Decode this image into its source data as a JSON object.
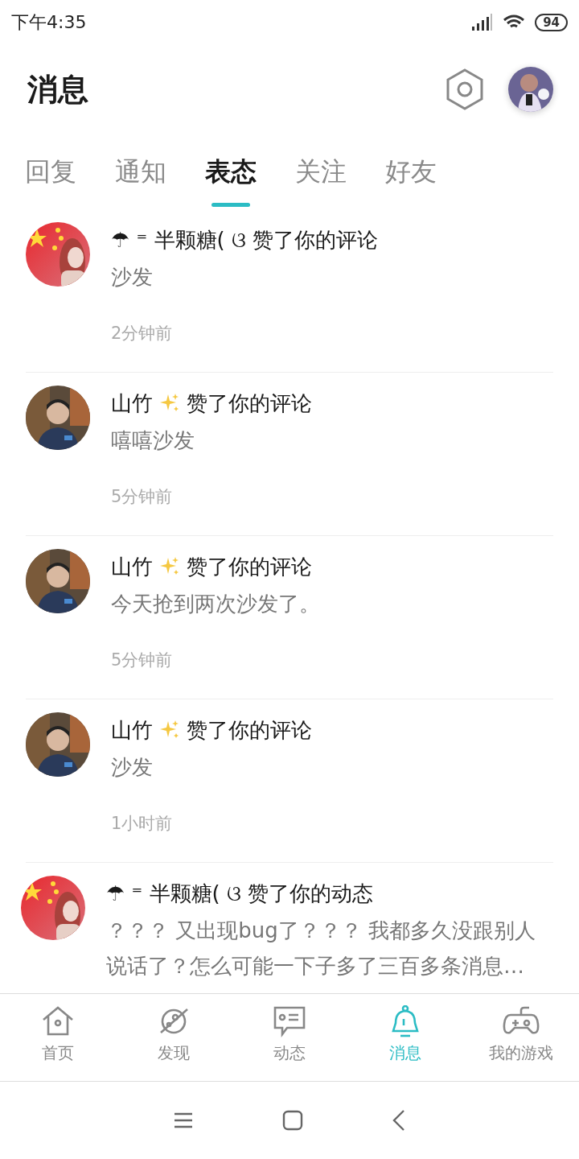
{
  "status_bar": {
    "time": "下午4:35",
    "battery": "94"
  },
  "header": {
    "title": "消息"
  },
  "tabs": [
    {
      "label": "回复",
      "selected": false
    },
    {
      "label": "通知",
      "selected": false
    },
    {
      "label": "表态",
      "selected": true
    },
    {
      "label": "关注",
      "selected": false
    },
    {
      "label": "好友",
      "selected": false
    }
  ],
  "messages": [
    {
      "kind": "flag",
      "name": "☂ ⁼ 半颗糖( ଓ",
      "sparkle": false,
      "action": "赞了你的评论",
      "content": "沙发",
      "time": "2分钟前"
    },
    {
      "kind": "person",
      "name": "山竹",
      "sparkle": true,
      "action": "赞了你的评论",
      "content": "嘻嘻沙发",
      "time": "5分钟前"
    },
    {
      "kind": "person",
      "name": "山竹",
      "sparkle": true,
      "action": "赞了你的评论",
      "content": "今天抢到两次沙发了。",
      "time": "5分钟前"
    },
    {
      "kind": "person",
      "name": "山竹",
      "sparkle": true,
      "action": "赞了你的评论",
      "content": "沙发",
      "time": "1小时前"
    },
    {
      "kind": "flag",
      "name": "☂ ⁼ 半颗糖( ଓ",
      "sparkle": false,
      "action": "赞了你的动态",
      "content": "？？？ 又出现bug了？？？ 我都多久没跟别人说话了？怎么可能一下子多了三百多条消息…"
    }
  ],
  "bottom_nav": [
    {
      "label": "首页",
      "kind": "home",
      "selected": false
    },
    {
      "label": "发现",
      "kind": "planet",
      "selected": false
    },
    {
      "label": "动态",
      "kind": "card",
      "selected": false
    },
    {
      "label": "消息",
      "kind": "bell",
      "selected": true
    },
    {
      "label": "我的游戏",
      "kind": "gamepad",
      "selected": false
    }
  ]
}
